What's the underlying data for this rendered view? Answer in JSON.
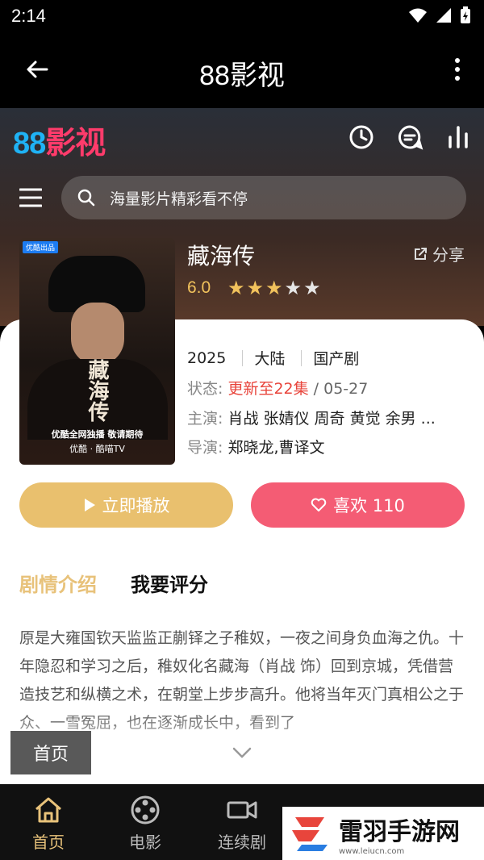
{
  "status_bar": {
    "time": "2:14"
  },
  "app_bar": {
    "title": "88影视"
  },
  "site": {
    "logo_number": "88",
    "logo_text": "影视",
    "search_placeholder": "海量影片精彩看不停"
  },
  "detail": {
    "poster": {
      "badge": "优酷出品",
      "title": "藏海传",
      "tagline": "优酷全网独播 敬请期待",
      "brands": "优酷 · 酷喵TV"
    },
    "title": "藏海传",
    "share_label": "分享",
    "rating": "6.0",
    "stars": {
      "filled": 3,
      "total": 5
    },
    "year": "2025",
    "region": "大陆",
    "genre": "国产剧",
    "status_label": "状态:",
    "status_value": "更新至22集",
    "status_date": " / 05-27",
    "cast_label": "主演:",
    "cast_value": "肖战 张婧仪 周奇 黄觉 余男 ...",
    "director_label": "导演:",
    "director_value": "郑晓龙,曹译文"
  },
  "actions": {
    "play_label": "立即播放",
    "like_label": "喜欢 110"
  },
  "tabs": {
    "plot": "剧情介绍",
    "rate": "我要评分"
  },
  "description": "原是大雍国钦天监监正蒯铎之子稚奴，一夜之间身负血海之仇。十年隐忍和学习之后，稚奴化名藏海（肖战 饰）回到京城，凭借营造技艺和纵横之术，在朝堂上步步高升。他将当年灭门真相公之于众、一雪冤屈，也在逐渐成长中，看到了",
  "floating_chip": "首页",
  "bottom_nav": [
    {
      "label": "首页",
      "icon": "home-icon",
      "active": true
    },
    {
      "label": "电影",
      "icon": "film-reel-icon",
      "active": false
    },
    {
      "label": "连续剧",
      "icon": "video-camera-icon",
      "active": false
    }
  ],
  "watermark": {
    "name": "雷羽手游网",
    "url": "www.leiucn.com"
  },
  "colors": {
    "accent_gold": "#e8c27a",
    "like_pink": "#f45c74",
    "play_gold": "#e9c06e",
    "status_red": "#e8453c"
  }
}
